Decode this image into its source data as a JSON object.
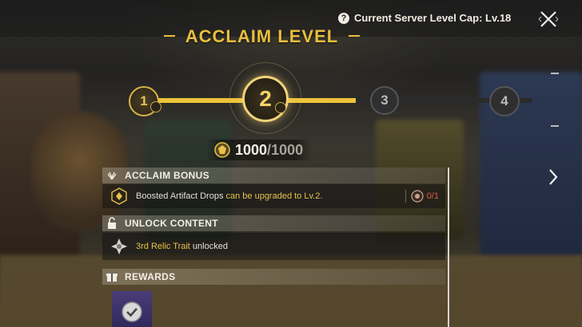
{
  "header": {
    "server_cap": "Current Server Level Cap: Lv.18",
    "help_icon": "?",
    "close_icon": "close-icon"
  },
  "title": "ACCLAIM LEVEL",
  "levels": {
    "current": 2,
    "nodes": [
      "1",
      "2",
      "3",
      "4"
    ],
    "progress_fraction": 0.6
  },
  "points": {
    "current": "1000",
    "separator": "/",
    "max": "1000"
  },
  "sections": {
    "acclaim_bonus": {
      "heading": "ACCLAIM BONUS",
      "text_before": "Boosted Artifact Drops ",
      "text_highlight": "can be upgraded to Lv.2.",
      "count": "0/1"
    },
    "unlock_content": {
      "heading": "UNLOCK CONTENT",
      "text_highlight": "3rd Relic Trait",
      "text_after": " unlocked"
    },
    "rewards": {
      "heading": "REWARDS",
      "claimed": true
    }
  },
  "colors": {
    "accent_gold": "#e8be3e",
    "progress_fill": "#f0c43a",
    "count_red": "#e05a4a",
    "reward_tile": "#4a3d7a"
  }
}
